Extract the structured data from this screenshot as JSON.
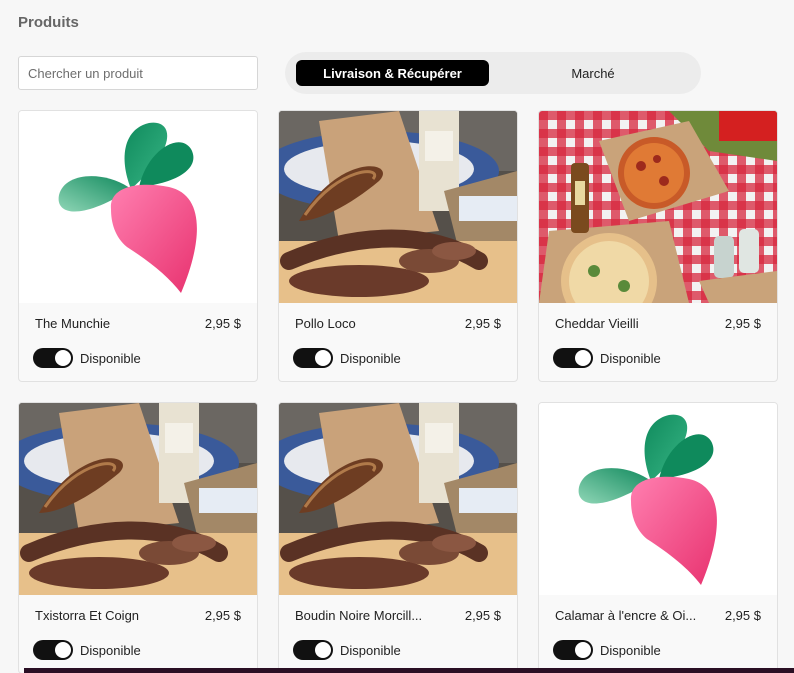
{
  "page": {
    "title": "Produits"
  },
  "search": {
    "placeholder": "Chercher un produit"
  },
  "tabs": [
    {
      "label": "Livraison & Récupérer",
      "active": true
    },
    {
      "label": "Marché",
      "active": false
    }
  ],
  "colors": {
    "accent": "#000000",
    "leaf_green": "#1a9b6c",
    "radish_pink": "#f04e87"
  },
  "products": [
    {
      "name": "The Munchie",
      "price": "2,95 $",
      "status": "Disponible",
      "available": true,
      "image": "radish-logo"
    },
    {
      "name": "Pollo Loco",
      "price": "2,95 $",
      "status": "Disponible",
      "available": true,
      "image": "charcuterie-photo"
    },
    {
      "name": "Cheddar Vieilli",
      "price": "2,95 $",
      "status": "Disponible",
      "available": true,
      "image": "pizza-picnic-photo"
    },
    {
      "name": "Txistorra Et Coign",
      "price": "2,95 $",
      "status": "Disponible",
      "available": true,
      "image": "charcuterie-photo"
    },
    {
      "name": "Boudin Noire Morcill...",
      "price": "2,95 $",
      "status": "Disponible",
      "available": true,
      "image": "charcuterie-photo"
    },
    {
      "name": "Calamar à l'encre & Oi...",
      "price": "2,95 $",
      "status": "Disponible",
      "available": true,
      "image": "radish-logo"
    }
  ]
}
